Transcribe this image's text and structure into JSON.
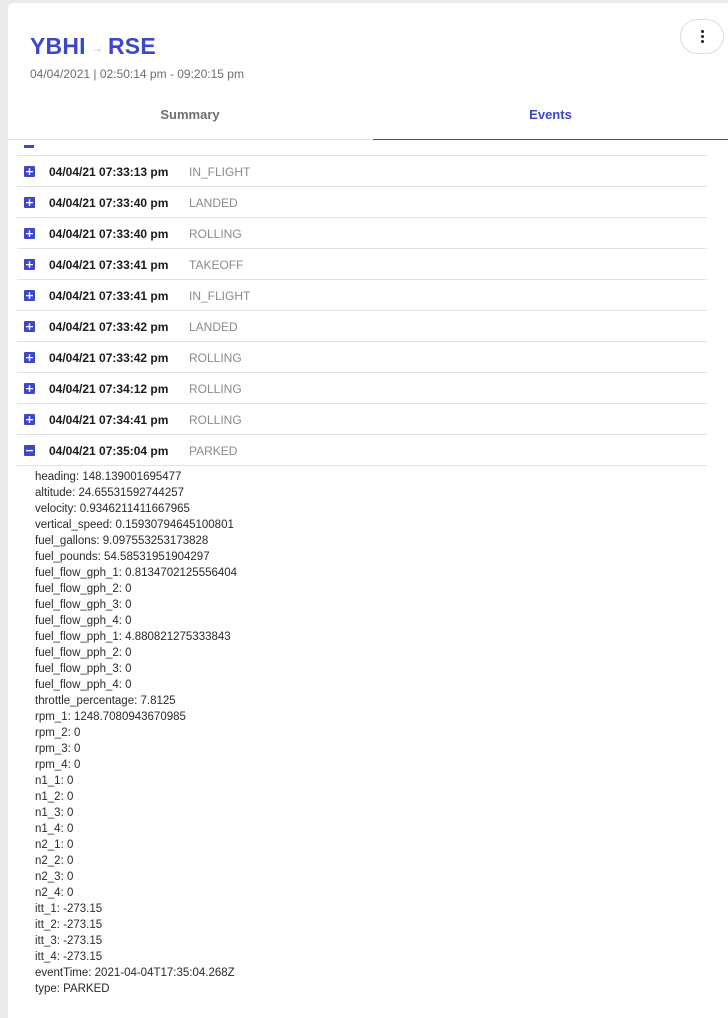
{
  "header": {
    "origin": "YBHI",
    "arrow": "→",
    "destination": "RSE",
    "subtitle": "04/04/2021 | 02:50:14 pm - 09:20:15 pm"
  },
  "menu_icon": "more-vertical-icon",
  "tabs": {
    "summary": "Summary",
    "events": "Events",
    "active": "Events"
  },
  "colors": {
    "accent": "#3d48c9",
    "muted": "#8a8a8a",
    "divider": "#e3e3e3"
  },
  "events": [
    {
      "time": "04/04/21 07:33:13 pm",
      "type": "IN_FLIGHT",
      "expanded": false
    },
    {
      "time": "04/04/21 07:33:40 pm",
      "type": "LANDED",
      "expanded": false
    },
    {
      "time": "04/04/21 07:33:40 pm",
      "type": "ROLLING",
      "expanded": false
    },
    {
      "time": "04/04/21 07:33:41 pm",
      "type": "TAKEOFF",
      "expanded": false
    },
    {
      "time": "04/04/21 07:33:41 pm",
      "type": "IN_FLIGHT",
      "expanded": false
    },
    {
      "time": "04/04/21 07:33:42 pm",
      "type": "LANDED",
      "expanded": false
    },
    {
      "time": "04/04/21 07:33:42 pm",
      "type": "ROLLING",
      "expanded": false
    },
    {
      "time": "04/04/21 07:34:12 pm",
      "type": "ROLLING",
      "expanded": false
    },
    {
      "time": "04/04/21 07:34:41 pm",
      "type": "ROLLING",
      "expanded": false
    },
    {
      "time": "04/04/21 07:35:04 pm",
      "type": "PARKED",
      "expanded": true
    }
  ],
  "expanded_details": [
    "heading: 148.139001695477",
    "altitude: 24.65531592744257",
    "velocity: 0.9346211411667965",
    "vertical_speed: 0.15930794645100801",
    "fuel_gallons: 9.097553253173828",
    "fuel_pounds: 54.58531951904297",
    "fuel_flow_gph_1: 0.8134702125556404",
    "fuel_flow_gph_2: 0",
    "fuel_flow_gph_3: 0",
    "fuel_flow_gph_4: 0",
    "fuel_flow_pph_1: 4.880821275333843",
    "fuel_flow_pph_2: 0",
    "fuel_flow_pph_3: 0",
    "fuel_flow_pph_4: 0",
    "throttle_percentage: 7.8125",
    "rpm_1: 1248.7080943670985",
    "rpm_2: 0",
    "rpm_3: 0",
    "rpm_4: 0",
    "n1_1: 0",
    "n1_2: 0",
    "n1_3: 0",
    "n1_4: 0",
    "n2_1: 0",
    "n2_2: 0",
    "n2_3: 0",
    "n2_4: 0",
    "itt_1: -273.15",
    "itt_2: -273.15",
    "itt_3: -273.15",
    "itt_4: -273.15",
    "eventTime: 2021-04-04T17:35:04.268Z",
    "type: PARKED"
  ]
}
